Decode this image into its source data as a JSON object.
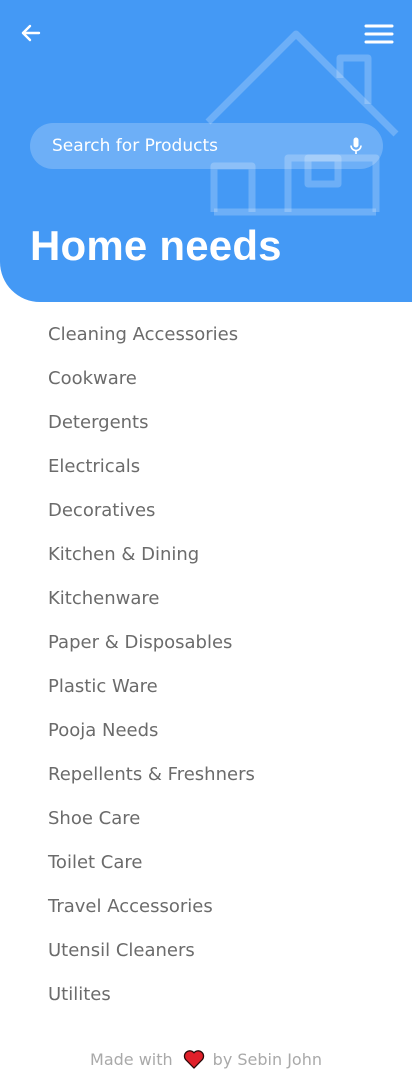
{
  "header": {
    "title": "Home needs",
    "search_placeholder": "Search for Products"
  },
  "icons": {
    "back": "arrow-left-icon",
    "menu": "hamburger-menu-icon",
    "mic": "microphone-icon",
    "background": "house-icon",
    "heart": "heart-icon"
  },
  "colors": {
    "accent": "#4499f5",
    "heart": "#e0202a"
  },
  "categories": [
    "Cleaning Accessories",
    "Cookware",
    "Detergents",
    "Electricals",
    "Decoratives",
    "Kitchen & Dining",
    "Kitchenware",
    "Paper & Disposables",
    "Plastic Ware",
    "Pooja Needs",
    "Repellents & Freshners",
    "Shoe Care",
    "Toilet Care",
    "Travel Accessories",
    "Utensil Cleaners",
    "Utilites"
  ],
  "footer": {
    "made_with": "Made with",
    "by": "by Sebin John"
  }
}
